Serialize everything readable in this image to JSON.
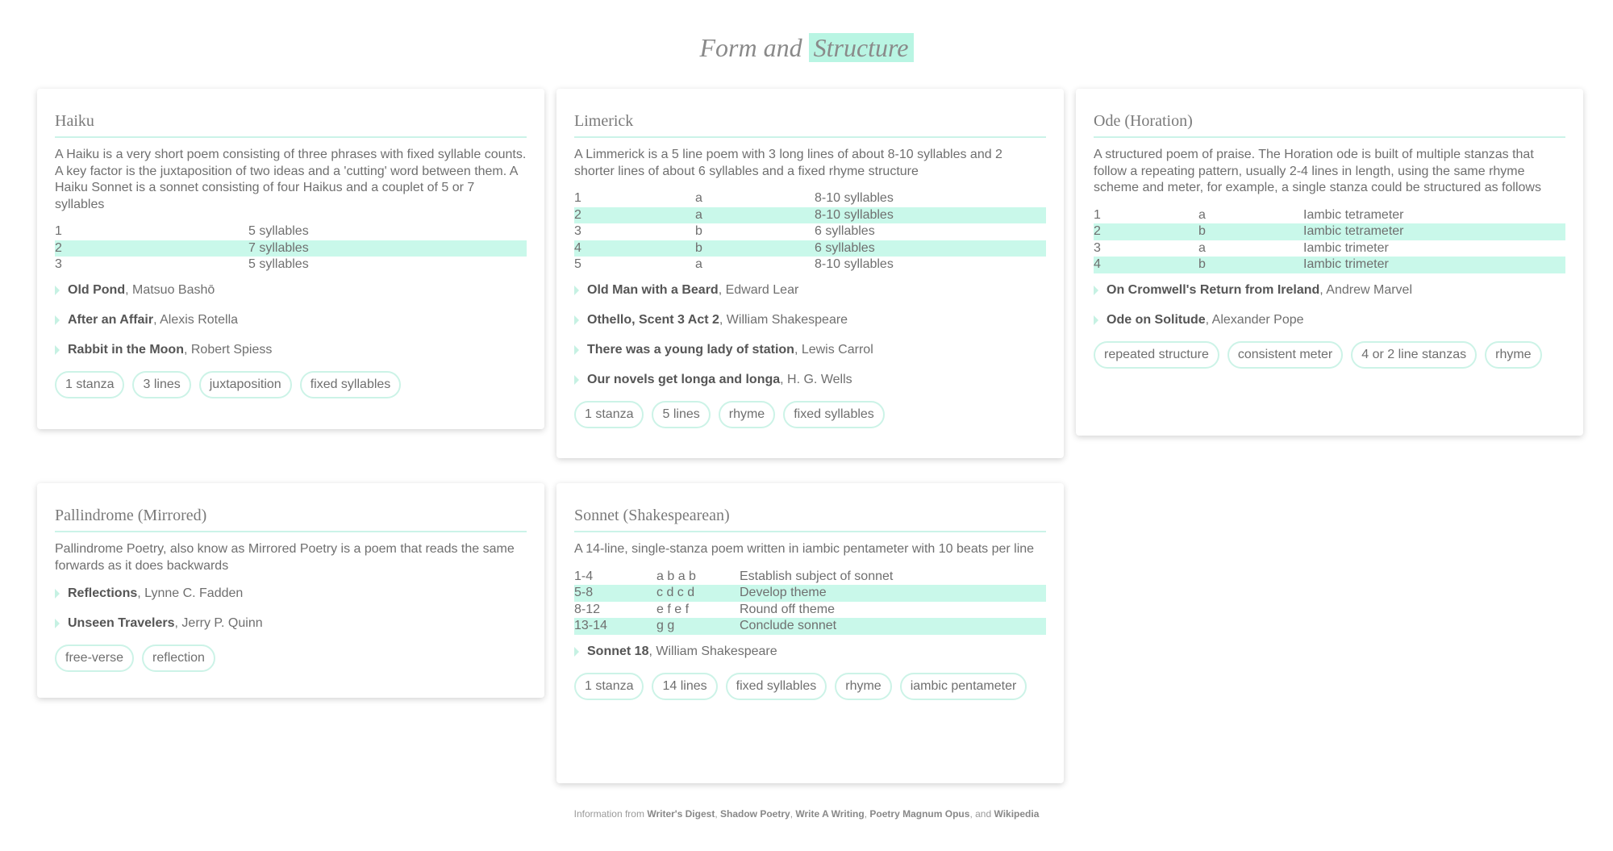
{
  "title": {
    "pre": "Form and",
    "highlight": "Structure"
  },
  "cards": {
    "haiku": {
      "title": "Haiku",
      "desc": "A Haiku is a very short poem consisting of three phrases with fixed syllable counts. A key factor is the juxtaposition of two ideas and a 'cutting' word between them. A Haiku Sonnet is a sonnet consisting of four Haikus and a couplet of 5 or 7 syllables",
      "rows": [
        [
          "1",
          "5 syllables"
        ],
        [
          "2",
          "7 syllables"
        ],
        [
          "3",
          "5 syllables"
        ]
      ],
      "examples": [
        {
          "title": "Old Pond",
          "author": ", Matsuo Bashō"
        },
        {
          "title": "After an Affair",
          "author": ", Alexis Rotella"
        },
        {
          "title": "Rabbit in the Moon",
          "author": ", Robert Spiess"
        }
      ],
      "tags": [
        "1 stanza",
        "3 lines",
        "juxtaposition",
        "fixed syllables"
      ]
    },
    "limerick": {
      "title": "Limerick",
      "desc": "A Limmerick is a 5 line poem with 3 long lines of about 8-10 syllables and 2 shorter lines of about 6 syllables and a fixed rhyme structure",
      "rows": [
        [
          "1",
          "a",
          "8-10 syllables"
        ],
        [
          "2",
          "a",
          "8-10 syllables"
        ],
        [
          "3",
          "b",
          "6 syllables"
        ],
        [
          "4",
          "b",
          "6 syllables"
        ],
        [
          "5",
          "a",
          "8-10 syllables"
        ]
      ],
      "examples": [
        {
          "title": "Old Man with a Beard",
          "author": ", Edward Lear"
        },
        {
          "title": "Othello, Scent 3 Act 2",
          "author": ", William Shakespeare"
        },
        {
          "title": "There was a young lady of station",
          "author": ", Lewis Carrol"
        },
        {
          "title": "Our novels get longa and longa",
          "author": ", H. G. Wells"
        }
      ],
      "tags": [
        "1 stanza",
        "5 lines",
        "rhyme",
        "fixed syllables"
      ]
    },
    "ode": {
      "title": "Ode (Horation)",
      "desc": "A structured poem of praise. The Horation ode is built of multiple stanzas that follow a repeating pattern, usually 2-4 lines in length, using the same rhyme scheme and meter, for example, a single stanza could be structured as follows",
      "rows": [
        [
          "1",
          "a",
          "Iambic tetrameter"
        ],
        [
          "2",
          "b",
          "Iambic tetrameter"
        ],
        [
          "3",
          "a",
          "Iambic trimeter"
        ],
        [
          "4",
          "b",
          "Iambic trimeter"
        ]
      ],
      "examples": [
        {
          "title": "On Cromwell's Return from Ireland",
          "author": ", Andrew Marvel"
        },
        {
          "title": "Ode on Solitude",
          "author": ", Alexander Pope"
        }
      ],
      "tags": [
        "repeated structure",
        "consistent meter",
        "4 or 2 line stanzas",
        "rhyme"
      ]
    },
    "palindrome": {
      "title": "Pallindrome (Mirrored)",
      "desc": "Pallindrome Poetry, also know as Mirrored Poetry is a poem that reads the same forwards as it does backwards",
      "examples": [
        {
          "title": "Reflections",
          "author": ", Lynne C. Fadden"
        },
        {
          "title": "Unseen Travelers",
          "author": ", Jerry P. Quinn"
        }
      ],
      "tags": [
        "free-verse",
        "reflection"
      ]
    },
    "sonnet": {
      "title": "Sonnet (Shakespearean)",
      "desc": "A 14-line, single-stanza poem written in iambic pentameter with 10 beats per line",
      "rows": [
        [
          "1-4",
          "a b a b",
          "Establish subject of sonnet"
        ],
        [
          "5-8",
          "c d c d",
          "Develop theme"
        ],
        [
          "8-12",
          "e f e f",
          "Round off theme"
        ],
        [
          "13-14",
          "g g",
          "Conclude sonnet"
        ]
      ],
      "examples": [
        {
          "title": "Sonnet 18",
          "author": ", William Shakespeare"
        }
      ],
      "tags": [
        "1 stanza",
        "14 lines",
        "fixed syllables",
        "rhyme",
        "iambic pentameter"
      ]
    }
  },
  "footer": {
    "prefix": "Information from",
    "sources": [
      "Writer's Digest",
      "Shadow Poetry",
      "Write A Writing",
      "Poetry Magnum Opus",
      "Wikipedia"
    ],
    "sep": ",",
    "and": ", and"
  },
  "colors": {
    "accent": "#c9f8ea",
    "title_highlight": "#b9f5e3"
  }
}
